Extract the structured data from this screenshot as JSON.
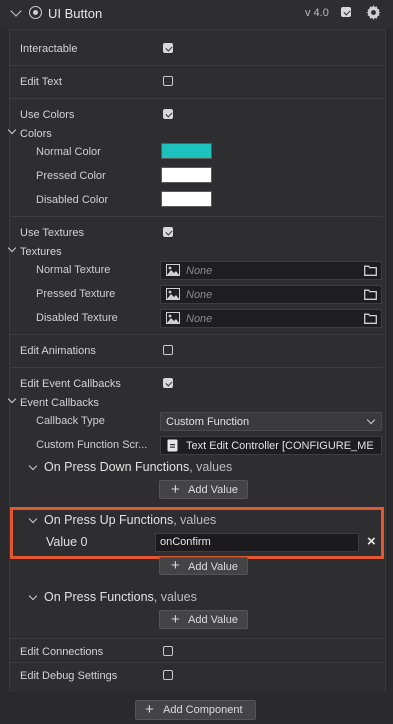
{
  "component": {
    "title": "UI Button",
    "version": "v 4.0",
    "enabled": true
  },
  "fields": {
    "interactable": {
      "label": "Interactable",
      "checked": true
    },
    "edit_text": {
      "label": "Edit Text",
      "checked": false
    },
    "use_colors": {
      "label": "Use Colors",
      "checked": true
    },
    "colors_group": "Colors",
    "normal_color": {
      "label": "Normal Color",
      "value": "#1ec2bc"
    },
    "pressed_color": {
      "label": "Pressed Color",
      "value": "#ffffff"
    },
    "disabled_color": {
      "label": "Disabled Color",
      "value": "#ffffff"
    },
    "use_textures": {
      "label": "Use Textures",
      "checked": true
    },
    "textures_group": "Textures",
    "normal_texture": {
      "label": "Normal Texture",
      "value": "None"
    },
    "pressed_texture": {
      "label": "Pressed Texture",
      "value": "None"
    },
    "disabled_texture": {
      "label": "Disabled Texture",
      "value": "None"
    },
    "edit_animations": {
      "label": "Edit Animations",
      "checked": false
    },
    "edit_event_callbacks": {
      "label": "Edit Event Callbacks",
      "checked": true
    },
    "event_callbacks_group": "Event Callbacks",
    "callback_type": {
      "label": "Callback Type",
      "value": "Custom Function"
    },
    "custom_function_script": {
      "label": "Custom Function Scr...",
      "value": "Text Edit Controller [CONFIGURE_ME"
    }
  },
  "sections": {
    "press_down": {
      "title": "On Press Down Functions",
      "suffix": ", values",
      "add_label": "Add Value"
    },
    "press_up": {
      "title": "On Press Up Functions",
      "suffix": ", values",
      "value_label": "Value 0",
      "value": "onConfirm",
      "add_label": "Add Value"
    },
    "press": {
      "title": "On Press Functions",
      "suffix": ", values",
      "add_label": "Add Value"
    }
  },
  "edit_connections": {
    "label": "Edit Connections",
    "checked": false
  },
  "edit_debug_settings": {
    "label": "Edit Debug Settings",
    "checked": false
  },
  "footer": {
    "add_component_label": "Add Component"
  },
  "colors": {
    "highlight": "#e4572e",
    "accent_teal": "#1ec2bc"
  }
}
